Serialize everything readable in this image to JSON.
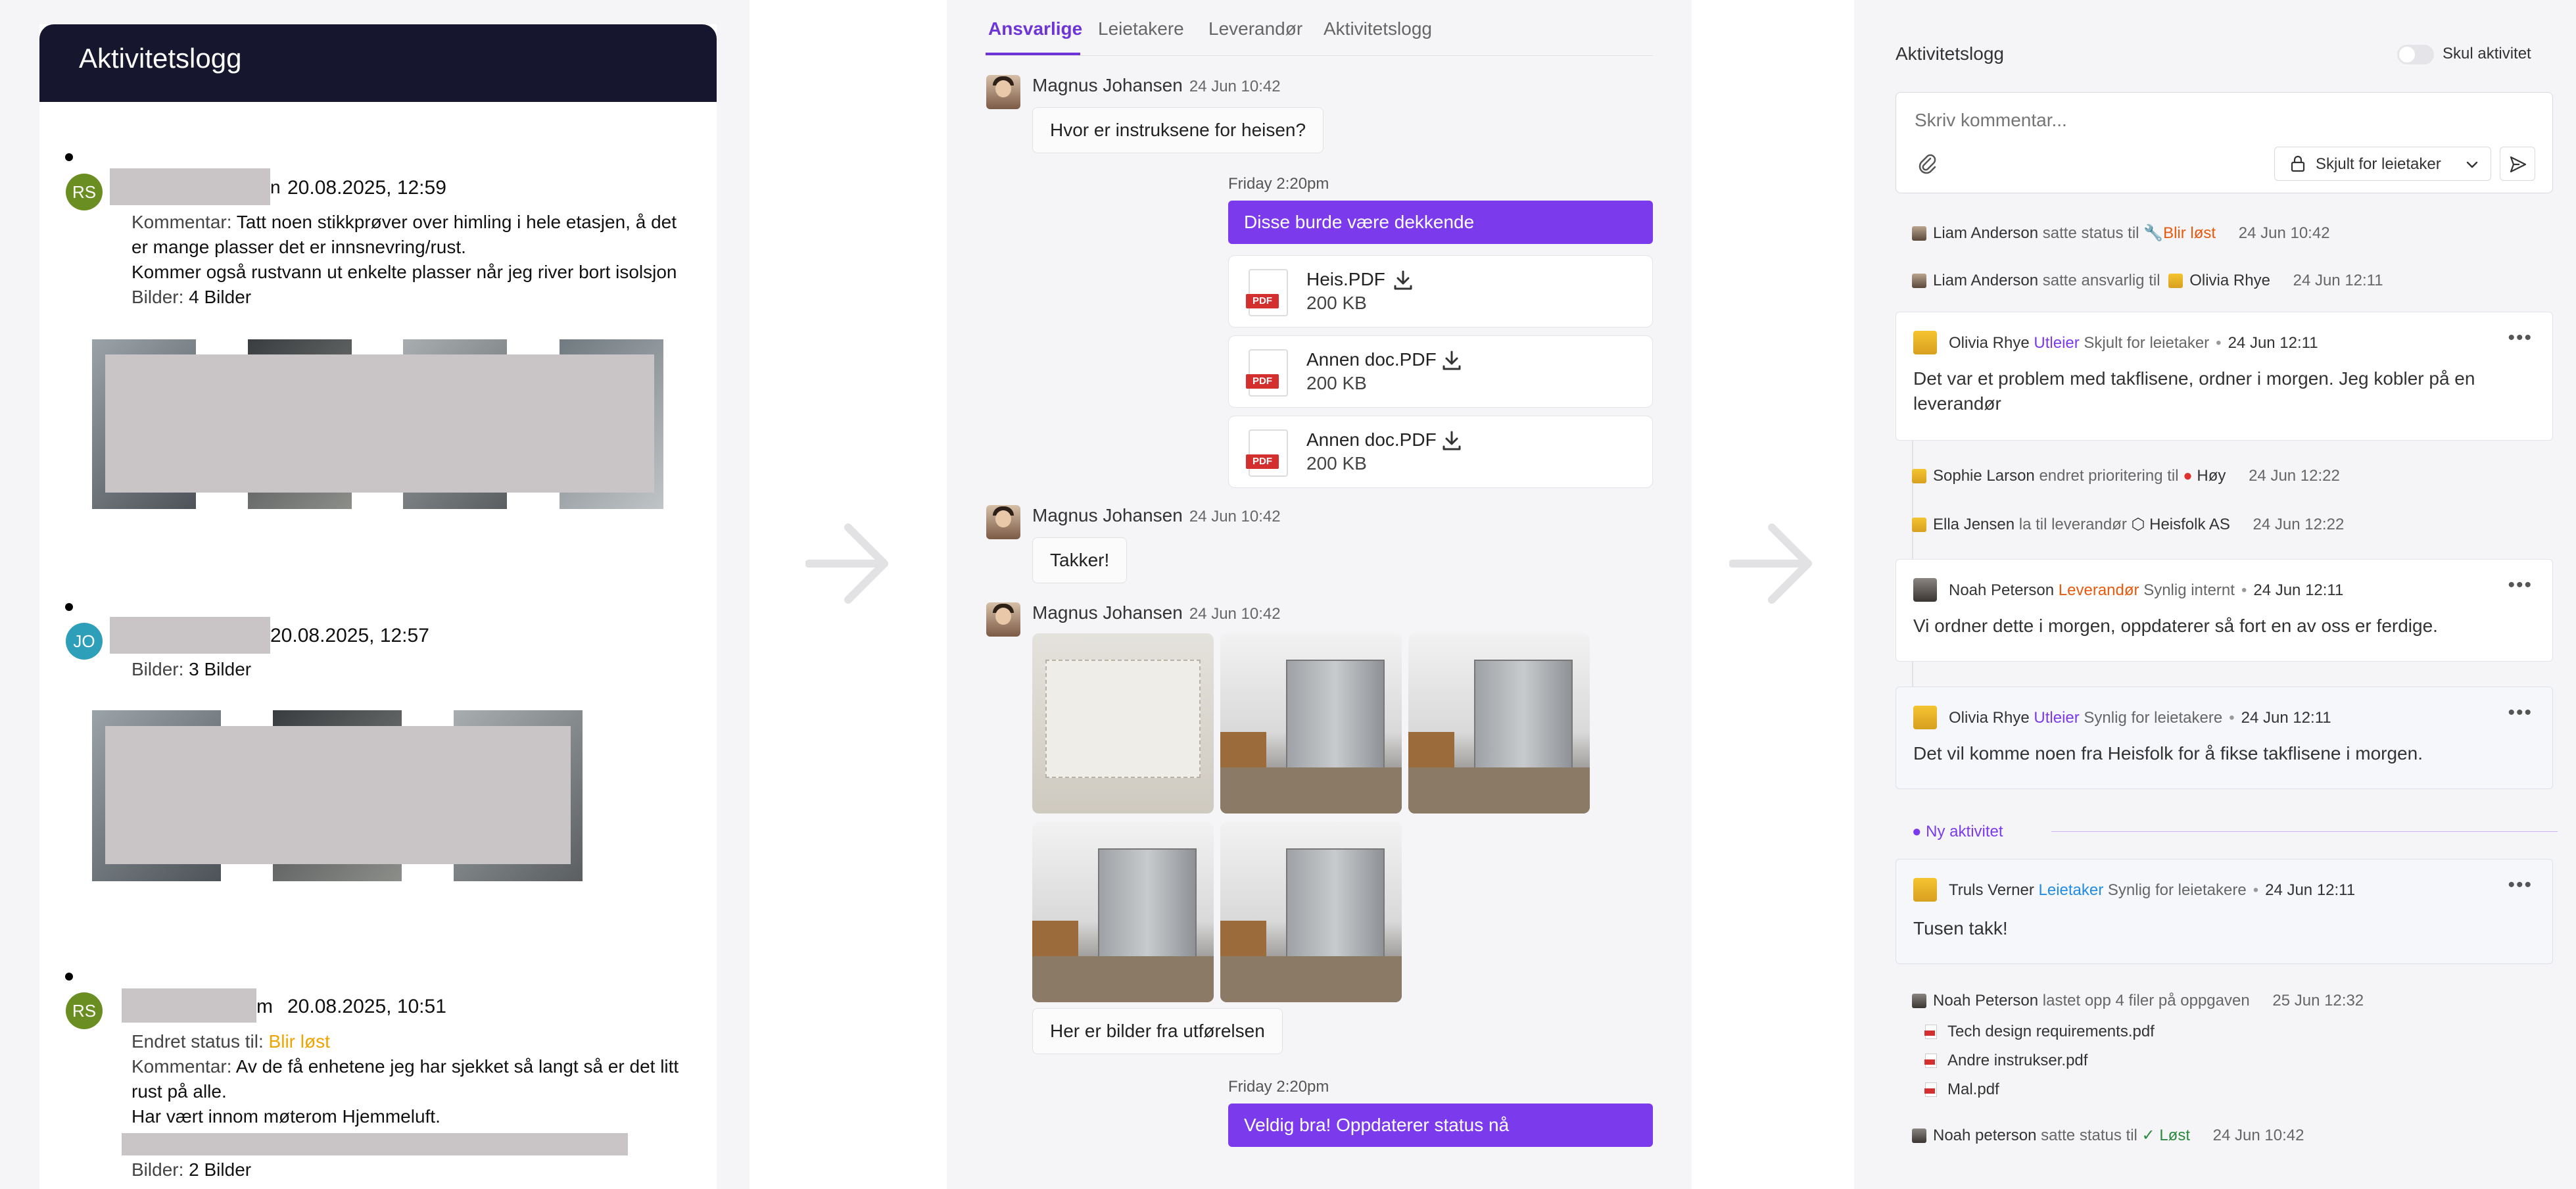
{
  "left_panel": {
    "header_title": "Aktivitetslogg",
    "entries": [
      {
        "initials": "RS",
        "avatar_color": "#6b8e23",
        "name_suffix": "n",
        "date": "20.08.2025, 12:59",
        "comment_label": "Kommentar:",
        "comment_lines": [
          "Tatt noen stikkprøver over himling i hele etasjen, å det",
          "er mange plasser det er innsnevring/rust.",
          "Kommer også rustvann ut enkelte plasser når jeg river bort isolsjon"
        ],
        "images_label": "Bilder:",
        "images_value": "4 Bilder"
      },
      {
        "initials": "JO",
        "avatar_color": "#2e9fb8",
        "date": "20.08.2025, 12:57",
        "images_label": "Bilder:",
        "images_value": "3 Bilder"
      },
      {
        "initials": "RS",
        "avatar_color": "#6b8e23",
        "name_suffix": "m",
        "date": "20.08.2025, 10:51",
        "status_label": "Endret status til:",
        "status_value": "Blir løst",
        "comment_label": "Kommentar:",
        "comment_lines": [
          "Av de få enhetene jeg har sjekket så langt så er det litt",
          "rust på alle.",
          "Har vært innom møterom Hjemmeluft."
        ],
        "images_label": "Bilder:",
        "images_value": "2 Bilder"
      }
    ]
  },
  "middle_panel": {
    "tabs": [
      "Ansvarlige",
      "Leietakere",
      "Leverandør",
      "Aktivitetslogg"
    ],
    "active_tab": "Ansvarlige",
    "messages": [
      {
        "author": "Magnus Johansen",
        "time": "24 Jun 10:42",
        "text": "Hvor er instruksene for heisen?"
      },
      {
        "author": "Magnus Johansen",
        "time": "24 Jun 10:42",
        "text": "Takker!"
      },
      {
        "author": "Magnus Johansen",
        "time": "24 Jun 10:42",
        "text": "Her er bilder fra utførelsen"
      }
    ],
    "outgoing": [
      {
        "time": "Friday 2:20pm",
        "text": "Disse burde være dekkende"
      },
      {
        "time": "Friday 2:20pm",
        "text": "Veldig bra! Oppdaterer status nå"
      }
    ],
    "files": [
      {
        "name": "Heis.PDF",
        "size": "200 KB"
      },
      {
        "name": "Annen doc.PDF",
        "size": "200 KB"
      },
      {
        "name": "Annen doc.PDF",
        "size": "200 KB"
      }
    ],
    "pdf_badge": "PDF"
  },
  "right_panel": {
    "title": "Aktivitetslogg",
    "toggle_label": "Skul aktivitet",
    "composer_placeholder": "Skriv kommentar...",
    "visibility_value": "Skjult for leietaker",
    "activities": [
      {
        "actor": "Liam Anderson",
        "verb": "satte status til",
        "value": "Blir løst",
        "time": "24 Jun 10:42"
      },
      {
        "actor": "Liam Anderson",
        "verb": "satte ansvarlig til",
        "value": "Olivia Rhye",
        "time": "24 Jun 12:11"
      },
      {
        "actor": "Sophie Larson",
        "verb": "endret prioritering til",
        "value": "Høy",
        "time": "24 Jun 12:22"
      },
      {
        "actor": "Ella Jensen",
        "verb": "la til leverandør",
        "value": "Heisfolk AS",
        "time": "24 Jun 12:22"
      }
    ],
    "cards": [
      {
        "author": "Olivia Rhye",
        "role": "Utleier",
        "visibility": "Skjult for leietaker",
        "time": "24 Jun 12:11",
        "body_lines": [
          "Det var et problem med takflisene, ordner i morgen. Jeg kobler på en",
          "leverandør"
        ]
      },
      {
        "author": "Noah Peterson",
        "role": "Leverandør",
        "visibility": "Synlig internt",
        "time": "24 Jun 12:11",
        "body_lines": [
          "Vi ordner dette i morgen, oppdaterer så fort en av oss er ferdige."
        ]
      },
      {
        "author": "Olivia Rhye",
        "role": "Utleier",
        "visibility": "Synlig for leietakere",
        "time": "24 Jun 12:11",
        "body_lines": [
          "Det vil komme noen fra Heisfolk for å fikse takflisene i morgen."
        ]
      },
      {
        "author": "Truls Verner",
        "role": "Leietaker",
        "visibility": "Synlig for leietakere",
        "time": "24 Jun 12:11",
        "body_lines": [
          "Tusen takk!"
        ]
      }
    ],
    "new_activity_label": "Ny aktivitet",
    "upload": {
      "actor": "Noah Peterson",
      "verb": "lastet opp 4 filer på oppgaven",
      "time": "25 Jun 12:32",
      "files": [
        "Tech design requirements.pdf",
        "Andre instrukser.pdf",
        "Mal.pdf"
      ]
    },
    "final_activity": {
      "actor": "Noah peterson",
      "verb": "satte status til",
      "value": "Løst",
      "time": "24 Jun 10:42"
    },
    "colors": {
      "accent": "#7c3aed",
      "status_orange": "#e8590c",
      "status_green": "#2b8a3e",
      "priority_red": "#e03131"
    }
  }
}
